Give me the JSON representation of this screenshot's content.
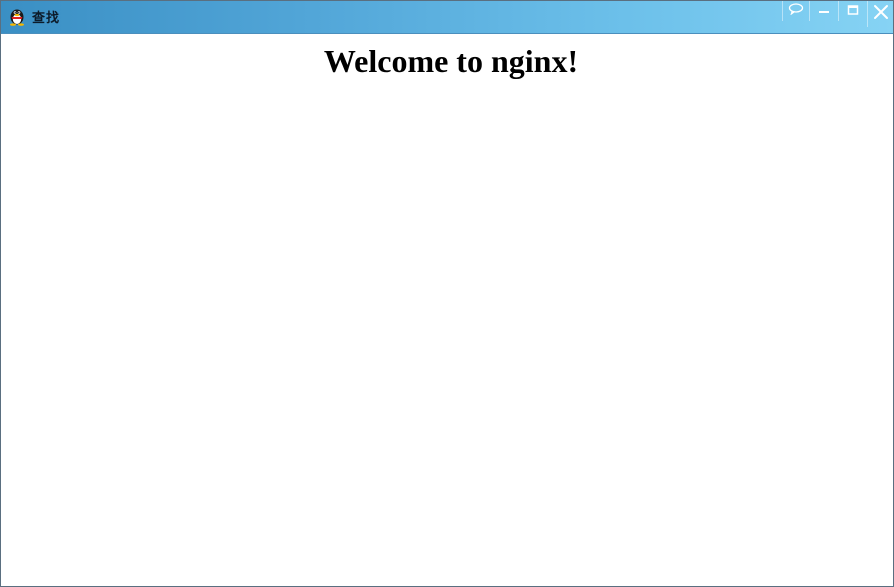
{
  "window": {
    "title": "查找"
  },
  "controls": {
    "feedback_icon": "speech-bubble-icon",
    "minimize_icon": "minimize-icon",
    "maximize_icon": "maximize-icon",
    "close_icon": "close-icon"
  },
  "page": {
    "heading": "Welcome to nginx!"
  },
  "colors": {
    "titlebar_start": "#3a8fc4",
    "titlebar_end": "#86d3f4",
    "content_background": "#ffffff"
  }
}
